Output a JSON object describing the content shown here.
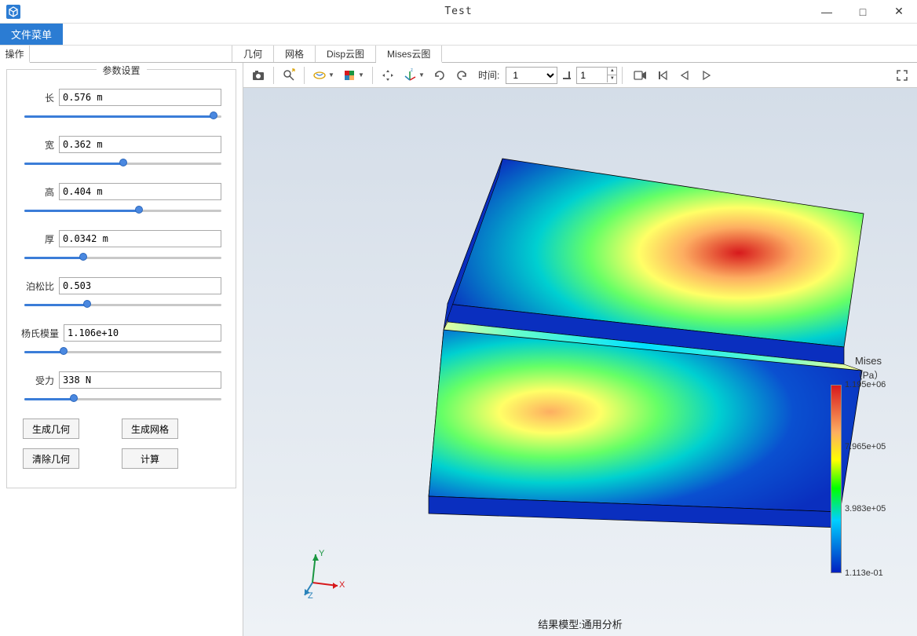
{
  "window": {
    "title": "Test",
    "min": "—",
    "max": "□",
    "close": "✕"
  },
  "menubar": {
    "file_menu": "文件菜单"
  },
  "left_tabs": {
    "operate": "操作"
  },
  "right_tabs": {
    "geometry": "几何",
    "mesh": "网格",
    "disp": "Disp云图",
    "mises": "Mises云图"
  },
  "sidebar": {
    "title": "参数设置",
    "params": {
      "length": {
        "label": "长",
        "value": "0.576 m",
        "pct": 96
      },
      "width": {
        "label": "宽",
        "value": "0.362 m",
        "pct": 50
      },
      "height": {
        "label": "高",
        "value": "0.404 m",
        "pct": 58
      },
      "thick": {
        "label": "厚",
        "value": "0.0342 m",
        "pct": 30
      },
      "poisson": {
        "label": "泊松比",
        "value": "0.503",
        "pct": 32
      },
      "youngs": {
        "label": "杨氏模量",
        "value": "1.106e+10",
        "pct": 20
      },
      "force": {
        "label": "受力",
        "value": "338 N",
        "pct": 25
      }
    },
    "buttons": {
      "gen_geom": "生成几何",
      "gen_mesh": "生成网格",
      "clear_geom": "清除几何",
      "compute": "计算"
    }
  },
  "toolbar": {
    "time_label": "时间:",
    "time_select": "1",
    "time_spin": "1"
  },
  "legend": {
    "title": "Mises",
    "unit": "（Pa）",
    "ticks": {
      "t0": "1.195e+06",
      "t1": "7.965e+05",
      "t2": "3.983e+05",
      "t3": "1.113e-01"
    }
  },
  "footer": {
    "text": "结果模型:通用分析"
  },
  "triad": {
    "x": "X",
    "y": "Y",
    "z": "Z"
  }
}
